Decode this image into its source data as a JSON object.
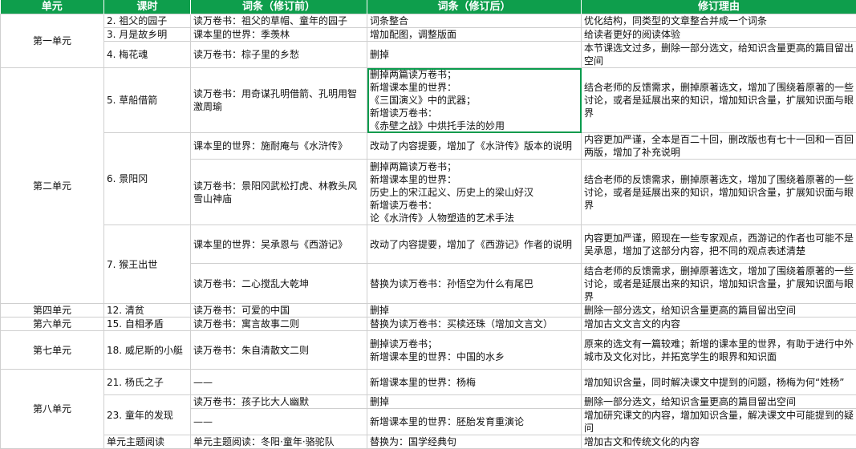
{
  "headers": {
    "unit": "单元",
    "lesson": "课时",
    "before": "词条（修订前）",
    "after": "词条（修订后）",
    "reason": "修订理由"
  },
  "rows": [
    {
      "unit": "第一单元",
      "lesson": "2. 祖父的园子",
      "before": "读万卷书：祖父的草帽、童年的园子",
      "after": "词条整合",
      "reason": "优化结构，同类型的文章整合并成一个词条"
    },
    {
      "lesson": "3. 月是故乡明",
      "before": "课本里的世界：季羡林",
      "after": "增加配图，调整版面",
      "reason": "给读者更好的阅读体验"
    },
    {
      "lesson": "4. 梅花魂",
      "before": "读万卷书：棕子里的乡愁",
      "after": "删掉",
      "reason": "本节课选文过多，删除一部分选文，给知识含量更高的篇目留出空间"
    },
    {
      "unit": "第二单元",
      "lesson": "5. 草船借箭",
      "before": "读万卷书：用奇谋孔明借箭、孔明用智激周瑜",
      "after": "删掉两篇读万卷书；\n新增课本里的世界：\n《三国演义》中的武器；\n新增读万卷书：\n《赤壁之战》中烘托手法的妙用",
      "reason": "结合老师的反馈需求，删掉原著选文，增加了围绕着原著的一些讨论，或者是延展出来的知识，增加知识含量，扩展知识面与眼界"
    },
    {
      "lesson": "6. 景阳冈",
      "before": "课本里的世界：施耐庵与《水浒传》",
      "after": "改动了内容提要，增加了《水浒传》版本的说明",
      "reason": "内容更加严谨，全本是百二十回，删改版也有七十一回和一百回两版，增加了补充说明"
    },
    {
      "before": "读万卷书：景阳冈武松打虎、林教头风雪山神庙",
      "after": "删掉两篇读万卷书；\n新增课本里的世界：\n历史上的宋江起义、历史上的梁山好汉\n新增读万卷书：\n论《水浒传》人物塑造的艺术手法",
      "reason": "结合老师的反馈需求，删掉原著选文，增加了围绕着原著的一些讨论，或者是延展出来的知识，增加知识含量，扩展知识面与眼界"
    },
    {
      "lesson": "7. 猴王出世",
      "before": "课本里的世界：吴承恩与《西游记》",
      "after": "改动了内容提要，增加了《西游记》作者的说明",
      "reason": "内容更加严谨，照现在一些专家观点，西游记的作者也可能不是吴承恩，增加了这部分内容，把不同的观点表述清楚"
    },
    {
      "before": "读万卷书：二心搅乱大乾坤",
      "after": "替换为读万卷书：孙悟空为什么有尾巴",
      "reason": "结合老师的反馈需求，删掉原著选文，增加了围绕着原著的一些讨论，或者是延展出来的知识，增加知识含量，扩展知识面与眼界"
    },
    {
      "unit": "第四单元",
      "lesson": "12. 清贫",
      "before": "读万卷书：可爱的中国",
      "after": "删掉",
      "reason": "删除一部分选文，给知识含量更高的篇目留出空间"
    },
    {
      "unit": "第六单元",
      "lesson": "15. 自相矛盾",
      "before": "读万卷书：寓言故事二则",
      "after": "替换为读万卷书：买椟还珠（增加文言文）",
      "reason": "增加古文文言文的内容"
    },
    {
      "unit": "第七单元",
      "lesson": "18. 威尼斯的小艇",
      "before": "读万卷书：朱自清散文二则",
      "after": "删掉读万卷书；\n新增课本里的世界：中国的水乡",
      "reason": "原来的选文有一篇较难；新增的课本里的世界，有助于进行中外城市及文化对比，并拓宽学生的眼界和知识面"
    },
    {
      "unit": "第八单元",
      "lesson": "21. 杨氏之子",
      "before": "——",
      "after": "新增课本里的世界：杨梅",
      "reason": "增加知识含量，同时解决课文中提到的问题，杨梅为何“姓杨”"
    },
    {
      "lesson": "23. 童年的发现",
      "before": "读万卷书：孩子比大人幽默",
      "after": "删掉",
      "reason": "删除一部分选文，给知识含量更高的篇目留出空间"
    },
    {
      "before": "——",
      "after": "新增课本里的世界：胚胎发育重演论",
      "reason": "增加研究课文的内容，增加知识含量，解决课文中可能提到的疑问"
    },
    {
      "lesson": "单元主题阅读",
      "before": "单元主题阅读：冬阳·童年·骆驼队",
      "after": "替换为：国学经典句",
      "reason": "增加古文和传统文化的内容"
    }
  ]
}
